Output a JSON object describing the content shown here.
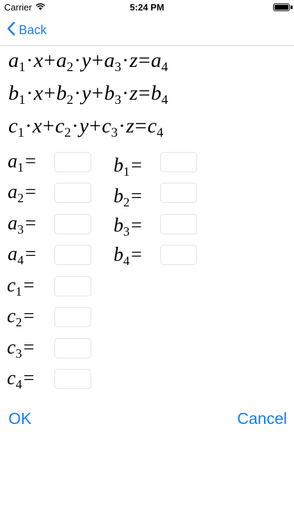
{
  "status_bar": {
    "carrier": "Carrier",
    "time": "5:24 PM",
    "wifi_icon": "wifi-icon",
    "battery_icon": "battery-icon",
    "battery_level": 1.0
  },
  "nav": {
    "back_label": "Back",
    "back_icon": "chevron-left-icon"
  },
  "equations": [
    {
      "rows": [
        {
          "letter": "a",
          "sub1": "1",
          "var1": "x",
          "sub2": "2",
          "var2": "y",
          "sub3": "3",
          "var3": "z",
          "sub4": "4"
        },
        {
          "letter": "b",
          "sub1": "1",
          "var1": "x",
          "sub2": "2",
          "var2": "y",
          "sub3": "3",
          "var3": "z",
          "sub4": "4"
        },
        {
          "letter": "c",
          "sub1": "1",
          "var1": "x",
          "sub2": "2",
          "var2": "y",
          "sub3": "3",
          "var3": "z",
          "sub4": "4"
        }
      ]
    }
  ],
  "coefficients": {
    "a": [
      {
        "letter": "a",
        "sub": "1",
        "value": "",
        "placeholder": ""
      },
      {
        "letter": "a",
        "sub": "2",
        "value": "",
        "placeholder": ""
      },
      {
        "letter": "a",
        "sub": "3",
        "value": "",
        "placeholder": ""
      },
      {
        "letter": "a",
        "sub": "4",
        "value": "",
        "placeholder": ""
      }
    ],
    "b": [
      {
        "letter": "b",
        "sub": "1",
        "value": "",
        "placeholder": ""
      },
      {
        "letter": "b",
        "sub": "2",
        "value": "",
        "placeholder": ""
      },
      {
        "letter": "b",
        "sub": "3",
        "value": "",
        "placeholder": ""
      },
      {
        "letter": "b",
        "sub": "4",
        "value": "",
        "placeholder": ""
      }
    ],
    "c": [
      {
        "letter": "c",
        "sub": "1",
        "value": "",
        "placeholder": ""
      },
      {
        "letter": "c",
        "sub": "2",
        "value": "",
        "placeholder": ""
      },
      {
        "letter": "c",
        "sub": "3",
        "value": "",
        "placeholder": ""
      },
      {
        "letter": "c",
        "sub": "4",
        "value": "",
        "placeholder": ""
      }
    ],
    "equals_sign": "="
  },
  "symbols": {
    "dot": "·",
    "plus": "+",
    "equals": "="
  },
  "buttons": {
    "ok_label": "OK",
    "cancel_label": "Cancel"
  },
  "colors": {
    "accent": "#1a7cf5",
    "separator": "#d8d8d8",
    "input_border": "#e2e2e2"
  }
}
